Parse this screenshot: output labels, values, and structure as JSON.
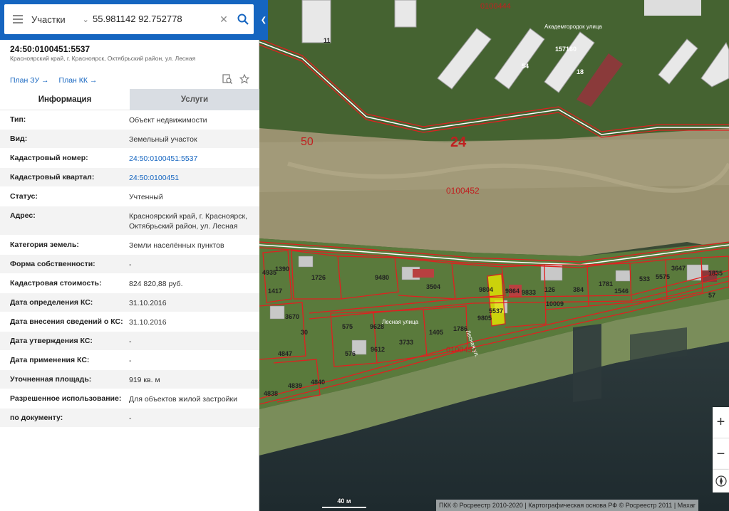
{
  "search": {
    "layer": "Участки",
    "query": "55.981142 92.752778"
  },
  "object": {
    "cadastral_number": "24:50:0100451:5537",
    "address": "Красноярский край, г. Красноярск, Октябрьский район, ул. Лесная",
    "plan_zu": "План ЗУ →",
    "plan_kk": "План КК →"
  },
  "tabs": [
    {
      "label": "Информация",
      "active": true
    },
    {
      "label": "Услуги",
      "active": false
    }
  ],
  "rows": [
    {
      "label": "Тип:",
      "value": "Объект недвижимости"
    },
    {
      "label": "Вид:",
      "value": "Земельный участок"
    },
    {
      "label": "Кадастровый номер:",
      "value": "24:50:0100451:5537"
    },
    {
      "label": "Кадастровый квартал:",
      "value": "24:50:0100451"
    },
    {
      "label": "Статус:",
      "value": "Учтенный"
    },
    {
      "label": "Адрес:",
      "value": "Красноярский край, г. Красноярск, Октябрьский район, ул. Лесная"
    },
    {
      "label": "Категория земель:",
      "value": "Земли населённых пунктов"
    },
    {
      "label": "Форма собственности:",
      "value": "-"
    },
    {
      "label": "Кадастровая стоимость:",
      "value": "824 820,88 руб."
    },
    {
      "label": "Дата определения КС:",
      "value": "31.10.2016"
    },
    {
      "label": "Дата внесения сведений о КС:",
      "value": "31.10.2016"
    },
    {
      "label": "Дата утверждения КС:",
      "value": "-"
    },
    {
      "label": "Дата применения КС:",
      "value": "-"
    },
    {
      "label": "Уточненная площадь:",
      "value": "919 кв. м"
    },
    {
      "label": "Разрешенное использование:",
      "value": "Для объектов жилой застройки"
    },
    {
      "label": "по документу:",
      "value": "-"
    }
  ],
  "map": {
    "labels_big": [
      "50",
      "24"
    ],
    "quarters": [
      "0100444",
      "0100452",
      "0100451"
    ],
    "street_top": "Академгородок улица",
    "street_mid": "Лесная улица",
    "street_side": "Лесная ул.",
    "parcel_numbers": [
      "11",
      "157160",
      "54",
      "18",
      "1390",
      "4935",
      "1726",
      "9480",
      "3504",
      "1417",
      "3670",
      "575",
      "9628",
      "1405",
      "1786",
      "3733",
      "9612",
      "576",
      "4847",
      "4839",
      "4840",
      "4838",
      "9804",
      "9805",
      "5537",
      "9864",
      "9833",
      "126",
      "10009",
      "384",
      "1781",
      "1546",
      "533",
      "5575",
      "3647",
      "1835",
      "57",
      "30"
    ],
    "scale": "40 м",
    "attribution": "ПКК © Росреестр 2010-2020 | Картографическая основа РФ © Росреестр 2011 | Maxar",
    "boundary_color": "#e02020",
    "selected_color": "#e8e800"
  }
}
